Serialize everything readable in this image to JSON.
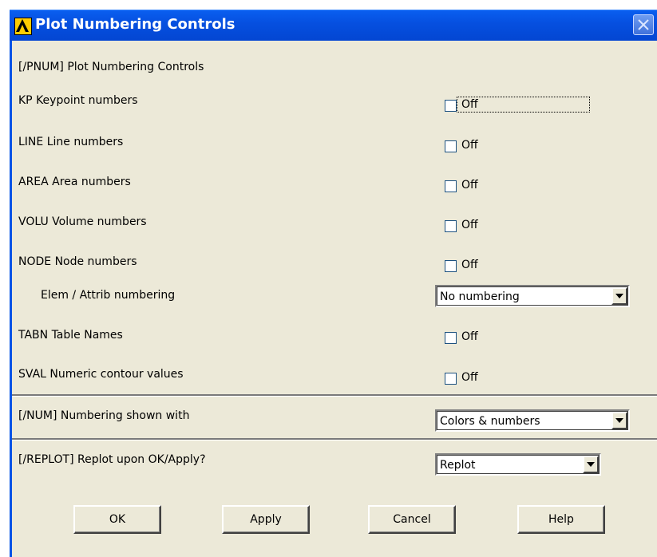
{
  "window": {
    "title": "Plot Numbering Controls",
    "close_icon": "close-icon",
    "logo_icon": "ansys-logo-icon"
  },
  "header": "[/PNUM]  Plot Numbering Controls",
  "rows": [
    {
      "key": "KP",
      "label": "KP    Keypoint numbers",
      "state": "Off",
      "checked": false
    },
    {
      "key": "LINE",
      "label": "LINE  Line numbers",
      "state": "Off",
      "checked": false
    },
    {
      "key": "AREA",
      "label": "AREA  Area numbers",
      "state": "Off",
      "checked": false
    },
    {
      "key": "VOLU",
      "label": "VOLU  Volume numbers",
      "state": "Off",
      "checked": false
    },
    {
      "key": "NODE",
      "label": "NODE  Node numbers",
      "state": "Off",
      "checked": false
    },
    {
      "key": "TABN",
      "label": "TABN  Table Names",
      "state": "Off",
      "checked": false
    },
    {
      "key": "SVAL",
      "label": "SVAL  Numeric contour values",
      "state": "Off",
      "checked": false
    }
  ],
  "elem": {
    "label": "Elem / Attrib numbering",
    "value": "No numbering"
  },
  "num": {
    "label": "[/NUM]  Numbering shown with",
    "value": "Colors & numbers"
  },
  "replot": {
    "label": "[/REPLOT] Replot upon OK/Apply?",
    "value": "Replot"
  },
  "buttons": {
    "ok": "OK",
    "apply": "Apply",
    "cancel": "Cancel",
    "help": "Help"
  },
  "colors": {
    "titlebar": "#0650e0",
    "dialog_bg": "#ece9d8",
    "logo": "#ffcc00"
  }
}
